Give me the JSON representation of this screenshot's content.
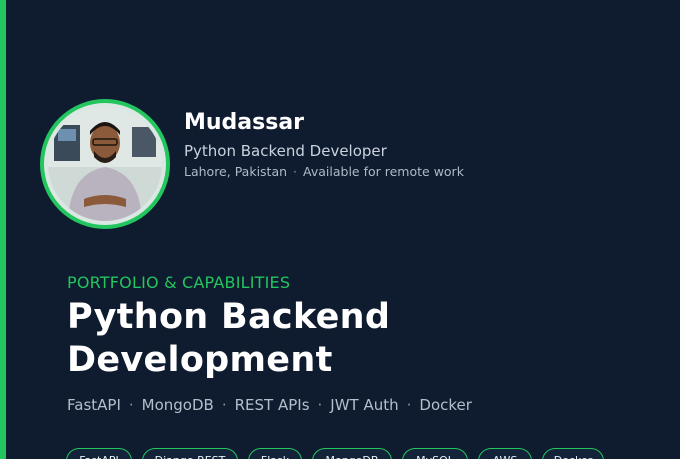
{
  "profile": {
    "name": "Mudassar",
    "role": "Python Backend Developer",
    "location": "Lahore, Pakistan",
    "separator": "·",
    "availability": "Available for remote work"
  },
  "hero": {
    "kicker": "PORTFOLIO & CAPABILITIES",
    "headline_line1": "Python Backend",
    "headline_line2": "Development"
  },
  "stack": {
    "separator": "·",
    "items": [
      "FastAPI",
      "MongoDB",
      "REST APIs",
      "JWT Auth",
      "Docker"
    ]
  },
  "chips": {
    "items": [
      "FastAPI",
      "Django REST",
      "Flask",
      "MongoDB",
      "MySQL",
      "AWS",
      "Docker"
    ]
  },
  "colors": {
    "background": "#0f1b2e",
    "accent": "#22c55e",
    "text_primary": "#ffffff",
    "text_secondary": "#c9d2de"
  },
  "icons": {
    "avatar": "profile-photo"
  }
}
